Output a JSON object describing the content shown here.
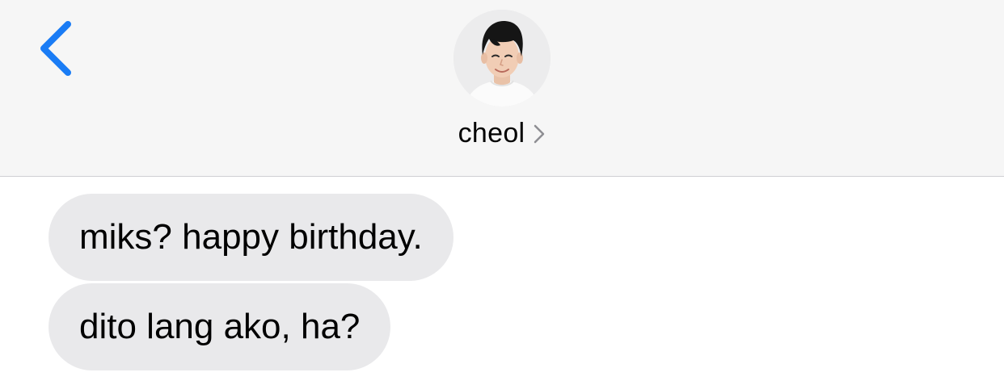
{
  "header": {
    "back_icon": "chevron-left-icon",
    "accent_color": "#1a7cf5",
    "contact": {
      "name": "cheol",
      "avatar": "profile-photo",
      "disclosure_icon": "chevron-right-icon"
    }
  },
  "messages": [
    {
      "direction": "received",
      "text": "miks? happy birthday."
    },
    {
      "direction": "received",
      "text": "dito lang ako, ha?"
    }
  ],
  "colors": {
    "header_background": "#f6f6f6",
    "received_bubble": "#e9e9eb",
    "chat_background": "#ffffff"
  }
}
